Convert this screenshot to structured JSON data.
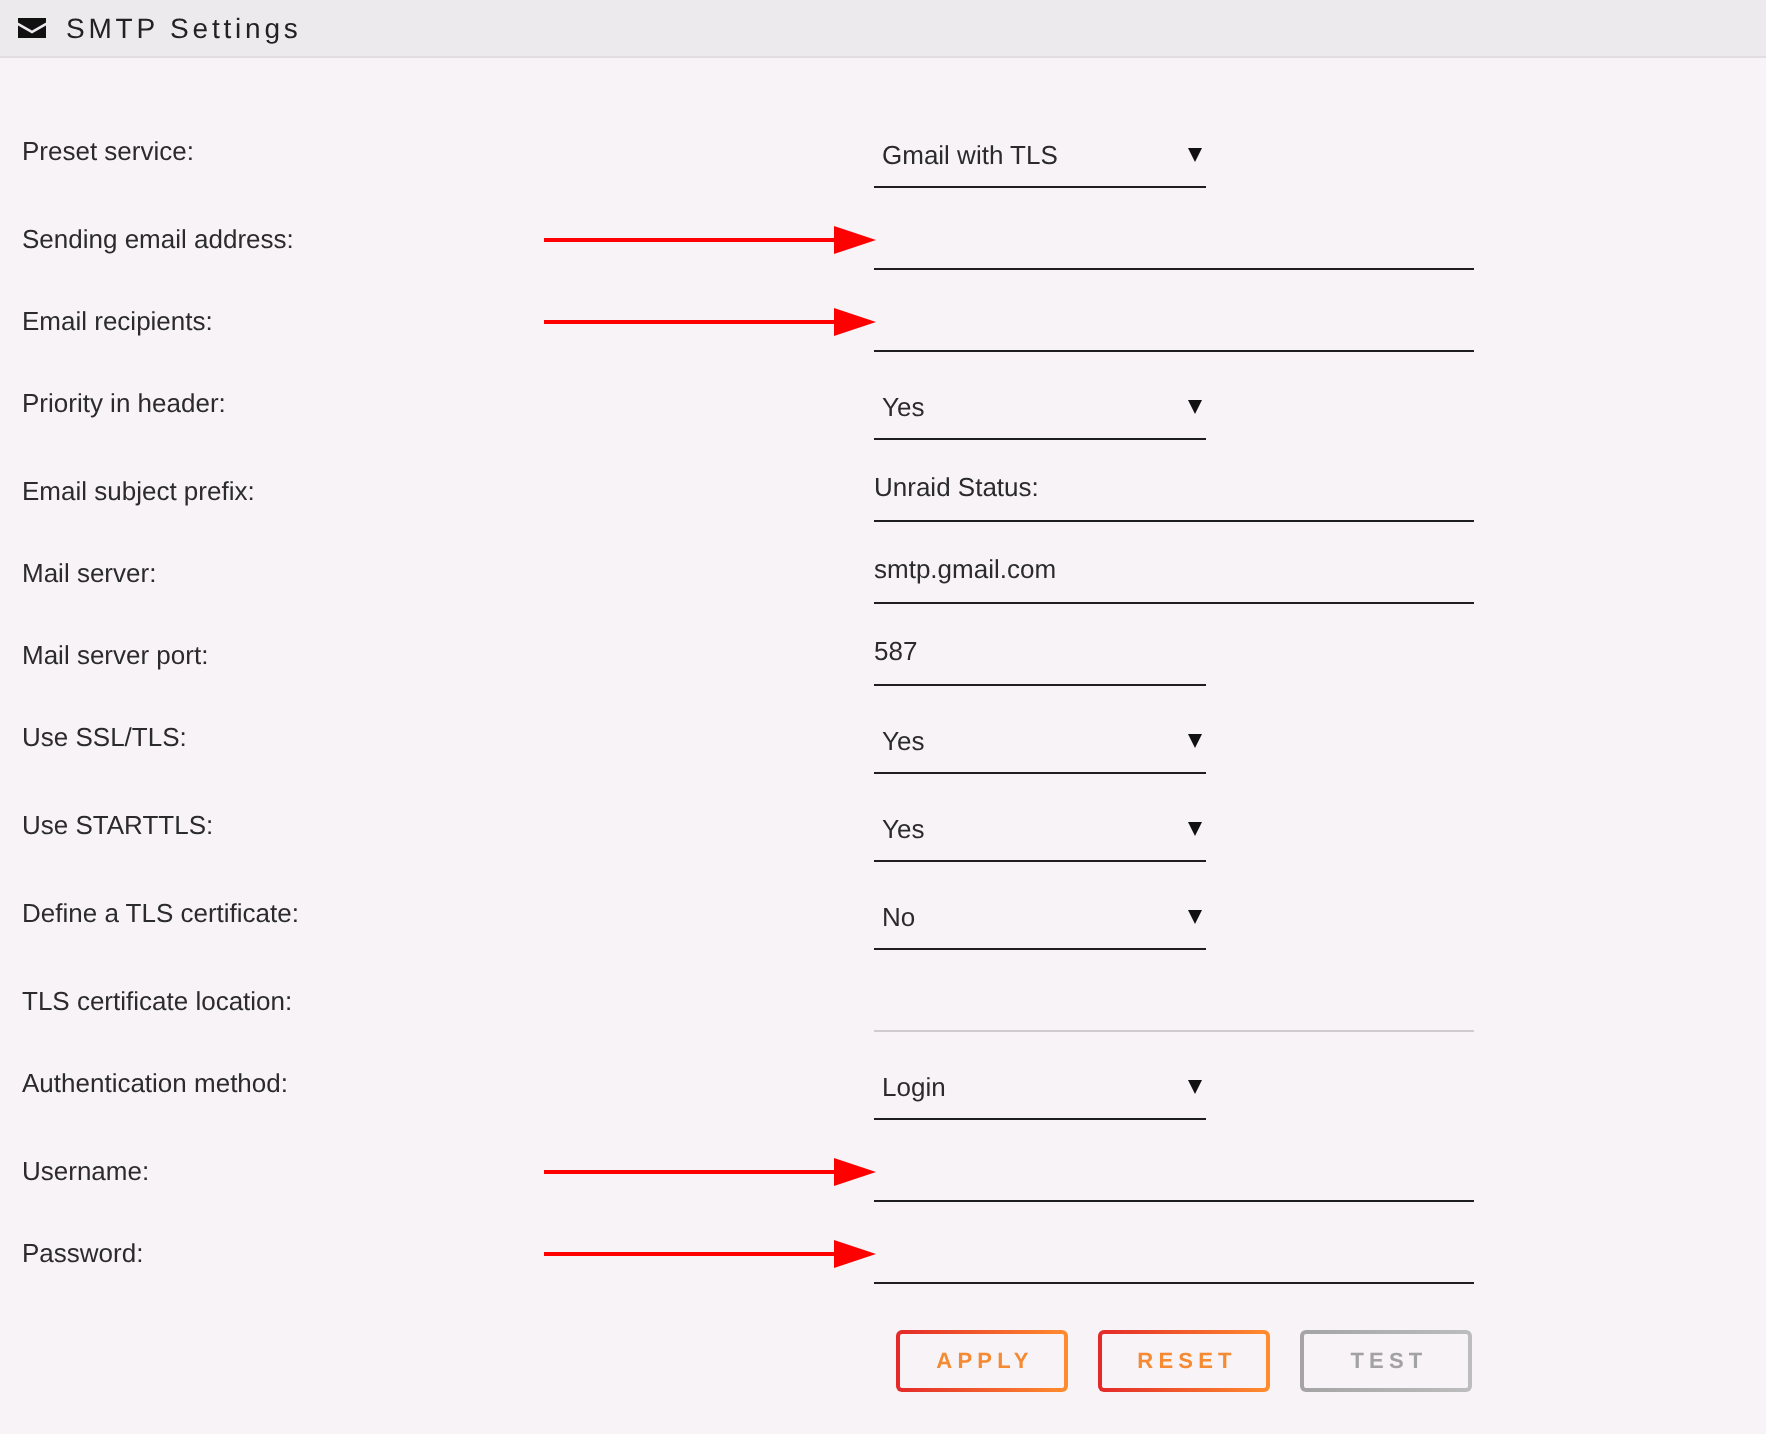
{
  "header": {
    "title": "SMTP Settings"
  },
  "rows": [
    {
      "label": "Preset service:",
      "kind": "select",
      "value": "Gmail with TLS",
      "disabled": false,
      "arrow": false
    },
    {
      "label": "Sending email address:",
      "kind": "text",
      "disabled": false,
      "arrow": true
    },
    {
      "label": "Email recipients:",
      "kind": "text",
      "disabled": false,
      "arrow": true
    },
    {
      "label": "Priority in header:",
      "kind": "select",
      "value": "Yes",
      "disabled": false,
      "arrow": false
    },
    {
      "label": "Email subject prefix:",
      "kind": "text",
      "value": "Unraid Status:",
      "disabled": false,
      "arrow": false
    },
    {
      "label": "Mail server:",
      "kind": "text",
      "value": "smtp.gmail.com",
      "disabled": false,
      "arrow": false
    },
    {
      "label": "Mail server port:",
      "kind": "number",
      "value": "587",
      "disabled": false,
      "arrow": false
    },
    {
      "label": "Use SSL/TLS:",
      "kind": "select",
      "value": "Yes",
      "disabled": false,
      "arrow": false
    },
    {
      "label": "Use STARTTLS:",
      "kind": "select",
      "value": "Yes",
      "disabled": false,
      "arrow": false
    },
    {
      "label": "Define a TLS certificate:",
      "kind": "select",
      "value": "No",
      "disabled": false,
      "arrow": false
    },
    {
      "label": "TLS certificate location:",
      "kind": "text",
      "disabled": true,
      "arrow": false
    },
    {
      "label": "Authentication method:",
      "kind": "select",
      "value": "Login",
      "disabled": false,
      "arrow": false
    },
    {
      "label": "Username:",
      "kind": "text",
      "disabled": false,
      "arrow": true
    },
    {
      "label": "Password:",
      "kind": "text",
      "disabled": false,
      "arrow": true
    }
  ],
  "buttons": [
    {
      "label": "APPLY",
      "disabled": false
    },
    {
      "label": "RESET",
      "disabled": false
    },
    {
      "label": "TEST",
      "disabled": true
    }
  ]
}
